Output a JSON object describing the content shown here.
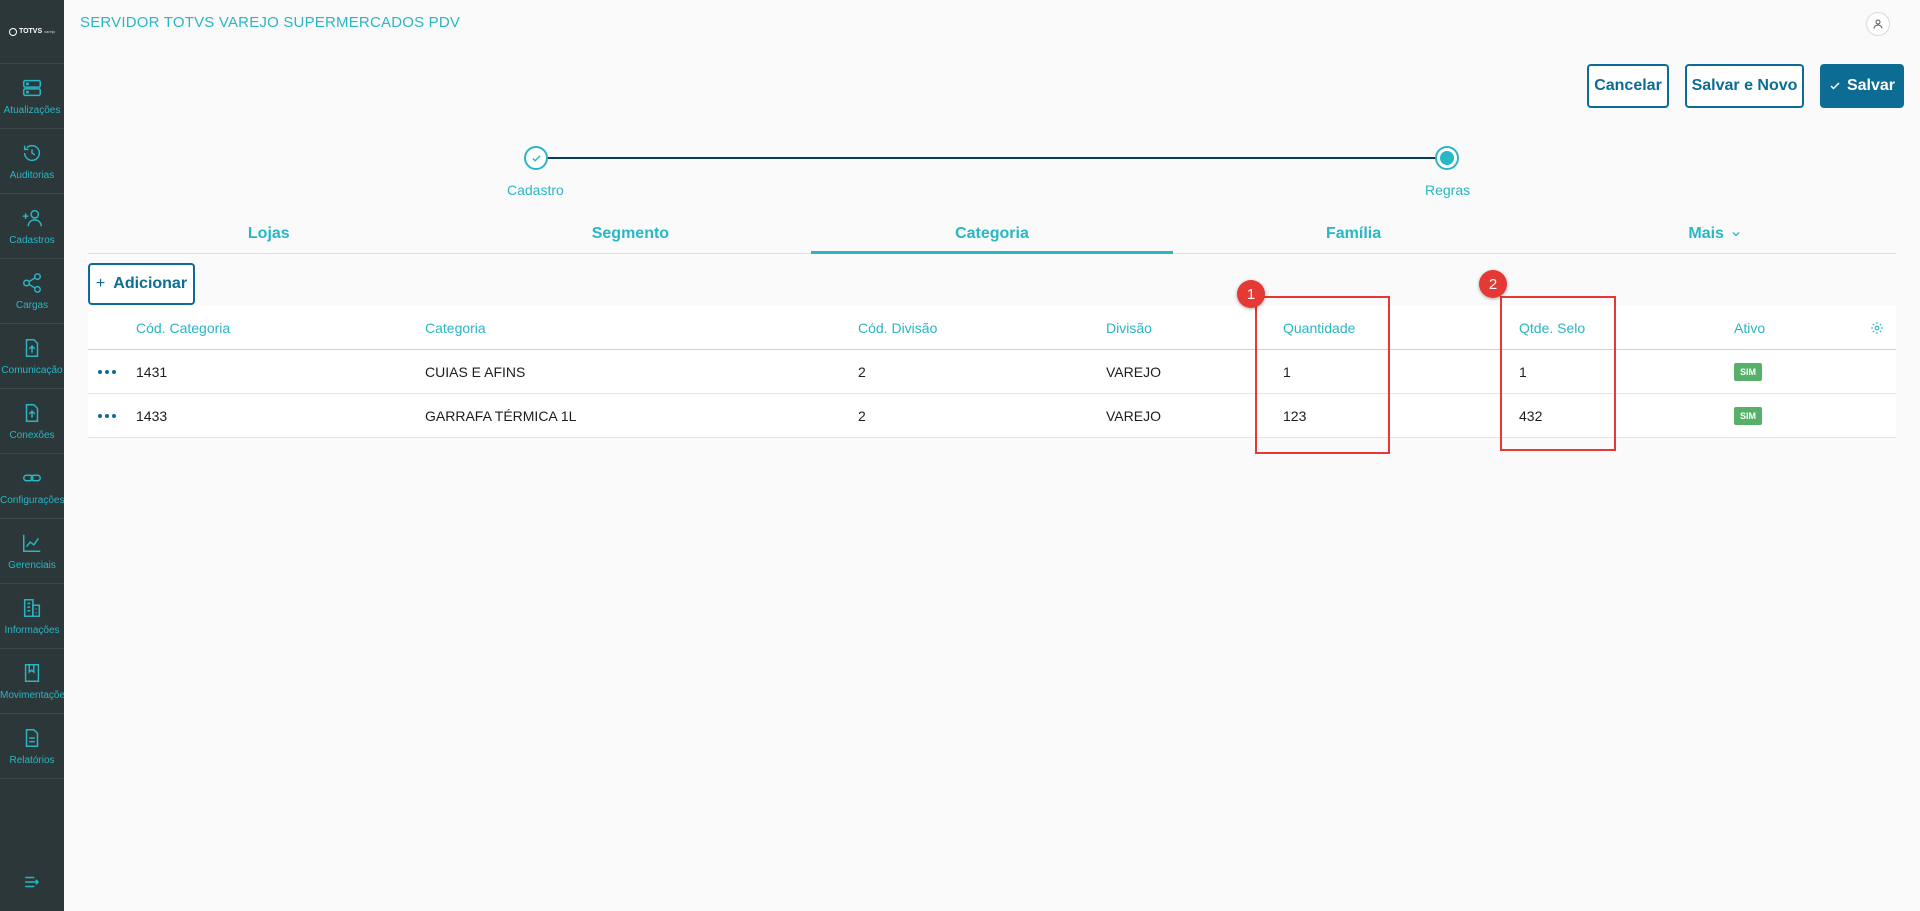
{
  "app": {
    "title": "SERVIDOR TOTVS VAREJO SUPERMERCADOS PDV",
    "logo_text": "TOTVS",
    "logo_sub": "varejo"
  },
  "sidebar": {
    "items": [
      {
        "label": "Atualizações",
        "icon": "server-icon"
      },
      {
        "label": "Auditorias",
        "icon": "history-icon"
      },
      {
        "label": "Cadastros",
        "icon": "add-user-icon"
      },
      {
        "label": "Cargas",
        "icon": "share-icon"
      },
      {
        "label": "Comunicação",
        "icon": "upload-file-icon"
      },
      {
        "label": "Conexões",
        "icon": "upload-file-icon"
      },
      {
        "label": "Configurações",
        "icon": "link-icon"
      },
      {
        "label": "Gerenciais",
        "icon": "chart-icon"
      },
      {
        "label": "Informações",
        "icon": "building-icon"
      },
      {
        "label": "Movimentações",
        "icon": "book-icon"
      },
      {
        "label": "Relatórios",
        "icon": "document-icon"
      }
    ]
  },
  "actions": {
    "cancel": "Cancelar",
    "save_new": "Salvar e Novo",
    "save": "Salvar",
    "add": "Adicionar"
  },
  "stepper": {
    "steps": [
      {
        "label": "Cadastro",
        "state": "done"
      },
      {
        "label": "Regras",
        "state": "current"
      }
    ]
  },
  "tabs": [
    {
      "label": "Lojas",
      "active": false
    },
    {
      "label": "Segmento",
      "active": false
    },
    {
      "label": "Categoria",
      "active": true
    },
    {
      "label": "Família",
      "active": false
    },
    {
      "label": "Mais",
      "active": false
    }
  ],
  "table": {
    "columns": [
      "Cód. Categoria",
      "Categoria",
      "Cód. Divisão",
      "Divisão",
      "Quantidade",
      "Qtde. Selo",
      "Ativo"
    ],
    "rows": [
      {
        "cod_categoria": "1431",
        "categoria": "CUIAS E AFINS",
        "cod_divisao": "2",
        "divisao": "VAREJO",
        "quantidade": "1",
        "qtde_selo": "1",
        "ativo": "SIM"
      },
      {
        "cod_categoria": "1433",
        "categoria": "GARRAFA TÉRMICA 1L",
        "cod_divisao": "2",
        "divisao": "VAREJO",
        "quantidade": "123",
        "qtde_selo": "432",
        "ativo": "SIM"
      }
    ]
  },
  "annotations": {
    "markers": [
      "1",
      "2"
    ],
    "color": "#e53935"
  },
  "colors": {
    "primary": "#0c6c94",
    "accent": "#29b6c5",
    "sidebar_bg": "#2c3739",
    "success": "#57b06a"
  }
}
